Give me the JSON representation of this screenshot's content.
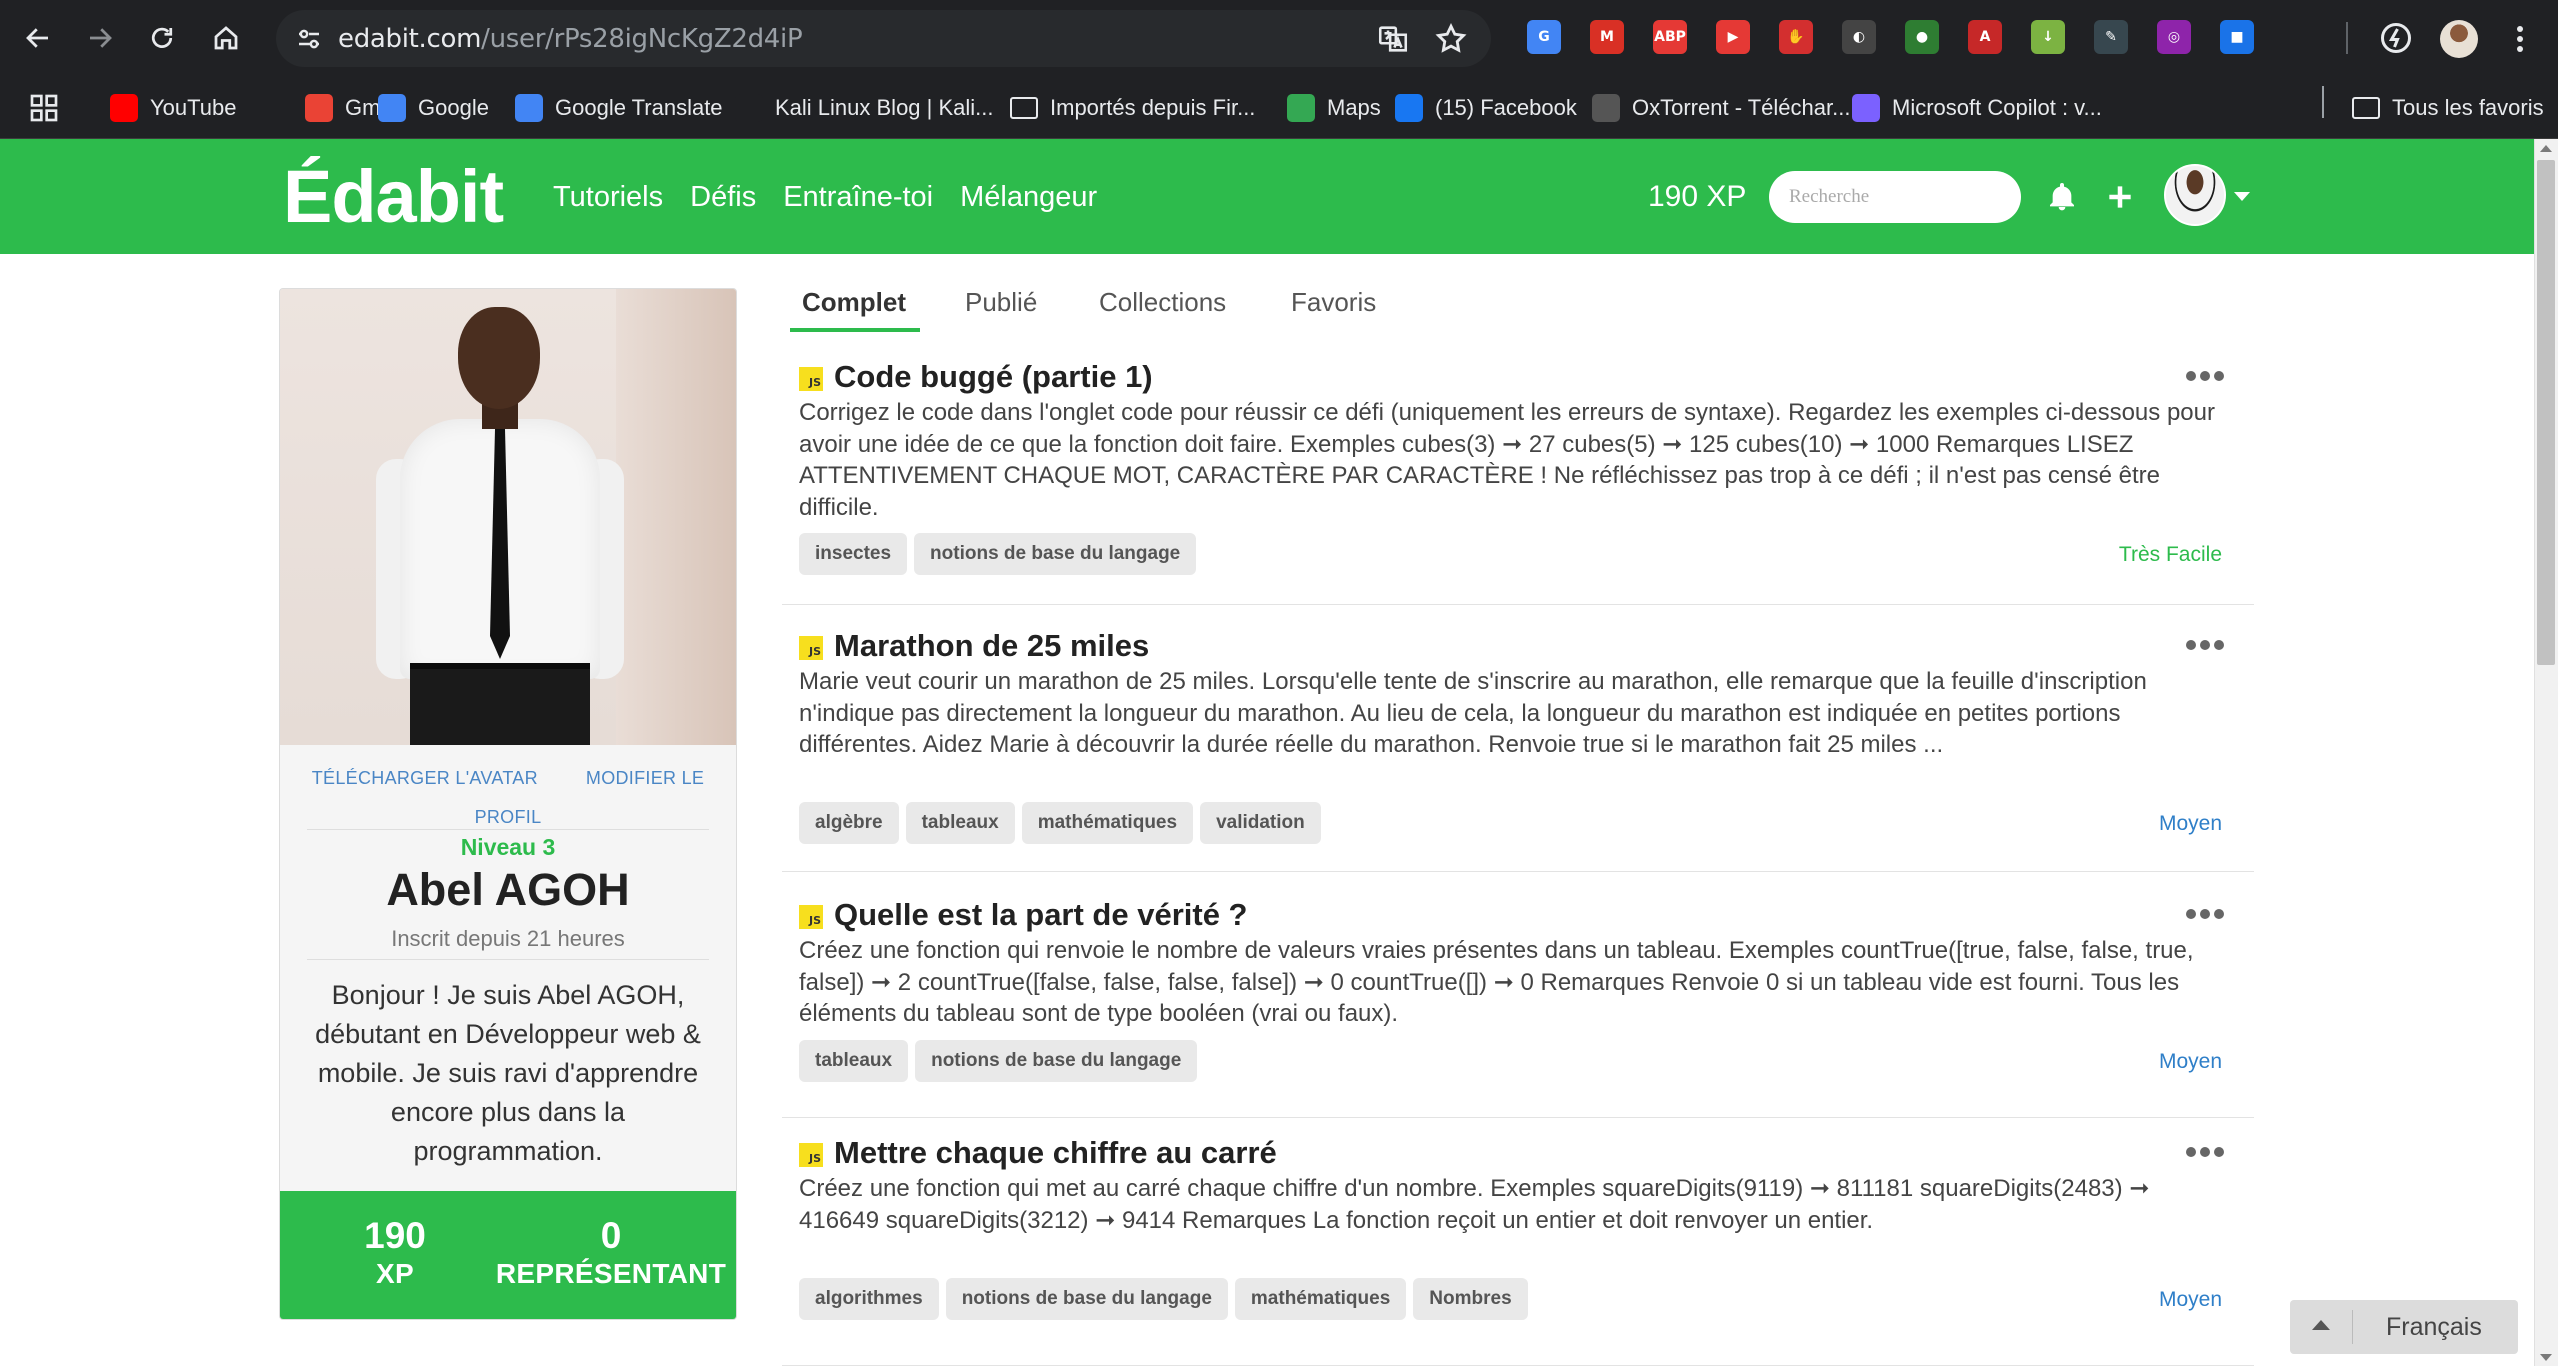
{
  "browser": {
    "url_host": "edabit.com",
    "url_path": "/user/rPs28igNcKgZ2d4iP",
    "extensions": [
      {
        "icon": "translate-ext-icon",
        "label": "G",
        "color": "#4285f4"
      },
      {
        "icon": "gmail-ext-icon",
        "label": "M",
        "color": "#d93025"
      },
      {
        "icon": "adblock-ext-icon",
        "label": "ABP",
        "color": "#e53935"
      },
      {
        "icon": "video-ext-icon",
        "label": "▶",
        "color": "#e53935"
      },
      {
        "icon": "stop-ext-icon",
        "label": "✋",
        "color": "#d32f2f"
      },
      {
        "icon": "dark-ext-icon",
        "label": "◐",
        "color": "#444444"
      },
      {
        "icon": "earth-ext-icon",
        "label": "●",
        "color": "#2e7d32"
      },
      {
        "icon": "pdf-ext-icon",
        "label": "A",
        "color": "#c62828"
      },
      {
        "icon": "download-ext-icon",
        "label": "↓",
        "color": "#7cb342"
      },
      {
        "icon": "eyedropper-ext-icon",
        "label": "✎",
        "color": "#37474f"
      },
      {
        "icon": "color-ext-icon",
        "label": "◎",
        "color": "#8e24aa"
      },
      {
        "icon": "badge-ext-icon",
        "label": "■",
        "color": "#1a73e8"
      }
    ],
    "bookmarks": [
      {
        "label": "YouTube",
        "icon": "youtube-icon",
        "color": "#ff0000"
      },
      {
        "label": "Gmail",
        "icon": "gmail-icon",
        "color": "#ea4335"
      },
      {
        "label": "Google",
        "icon": "google-icon",
        "color": "#4285f4"
      },
      {
        "label": "Google Translate",
        "icon": "translate-icon",
        "color": "#4285f4"
      },
      {
        "label": "Kali Linux Blog | Kali...",
        "icon": "kali-icon",
        "color": "#202124"
      },
      {
        "label": "Importés depuis Fir...",
        "icon": "folder-icon",
        "color": ""
      },
      {
        "label": "Maps",
        "icon": "maps-icon",
        "color": "#34a853"
      },
      {
        "label": "(15) Facebook",
        "icon": "facebook-icon",
        "color": "#1877f2"
      },
      {
        "label": "OxTorrent - Téléchar...",
        "icon": "oxtorrent-icon",
        "color": "#555555"
      },
      {
        "label": "Microsoft Copilot : v...",
        "icon": "copilot-icon",
        "color": "#7b61ff"
      }
    ],
    "all_bookmarks": "Tous les favoris"
  },
  "header": {
    "logo": "Édabit",
    "nav": [
      "Tutoriels",
      "Défis",
      "Entraîne-toi",
      "Mélangeur"
    ],
    "xp": "190 XP",
    "search_placeholder": "Recherche",
    "brand_color": "#2dbb4c"
  },
  "profile": {
    "upload_avatar": "TÉLÉCHARGER L'AVATAR",
    "edit_profile_1": "MODIFIER LE",
    "edit_profile_2": "PROFIL",
    "level": "Niveau 3",
    "name": "Abel AGOH",
    "joined": "Inscrit  depuis 21 heures",
    "bio": "Bonjour ! Je suis Abel AGOH, débutant en Développeur web & mobile. Je suis ravi d'apprendre encore plus dans la programmation.",
    "stats": [
      {
        "value": "190",
        "label": "XP"
      },
      {
        "value": "0",
        "label": "REPRÉSENTANT"
      }
    ]
  },
  "tabs": [
    "Complet",
    "Publié",
    "Collections",
    "Favoris"
  ],
  "challenges": [
    {
      "lang": "JS",
      "title": "Code buggé (partie 1)",
      "desc": "Corrigez le code dans l'onglet code pour réussir ce défi (uniquement les erreurs de syntaxe). Regardez les exemples ci-dessous pour avoir une idée de ce que la fonction doit faire. Exemples cubes(3) ➞ 27 cubes(5) ➞ 125 cubes(10) ➞ 1000 Remarques LISEZ ATTENTIVEMENT CHAQUE MOT, CARACTÈRE PAR CARACTÈRE ! Ne réfléchissez pas trop à ce défi ; il n'est pas censé être difficile.",
      "tags": [
        "insectes",
        "notions de base du langage"
      ],
      "difficulty": "Très Facile",
      "difficulty_color": "#2dbb4c"
    },
    {
      "lang": "JS",
      "title": "Marathon de 25 miles",
      "desc": "Marie veut courir un marathon de 25 miles. Lorsqu'elle tente de s'inscrire au marathon, elle remarque que la feuille d'inscription n'indique pas directement la longueur du marathon. Au lieu de cela, la longueur du marathon est indiquée en petites portions différentes. Aidez Marie à découvrir la durée réelle du marathon. Renvoie true si le marathon fait 25 miles ...",
      "tags": [
        "algèbre",
        "tableaux",
        "mathématiques",
        "validation"
      ],
      "difficulty": "Moyen",
      "difficulty_color": "#2f7fc8"
    },
    {
      "lang": "JS",
      "title": "Quelle est la part de vérité ?",
      "desc": "Créez une fonction qui renvoie le nombre de valeurs vraies présentes dans un tableau. Exemples countTrue([true, false, false, true, false]) ➞ 2 countTrue([false, false, false, false]) ➞ 0 countTrue([]) ➞ 0 Remarques Renvoie 0 si un tableau vide est fourni. Tous les éléments du tableau sont de type booléen (vrai ou faux).",
      "tags": [
        "tableaux",
        "notions de base du langage"
      ],
      "difficulty": "Moyen",
      "difficulty_color": "#2f7fc8"
    },
    {
      "lang": "JS",
      "title": "Mettre chaque chiffre au carré",
      "desc": "Créez une fonction qui met au carré chaque chiffre d'un nombre. Exemples squareDigits(9119) ➞ 811181 squareDigits(2483) ➞ 416649 squareDigits(3212) ➞ 9414 Remarques La fonction reçoit un entier et doit renvoyer un entier.",
      "tags": [
        "algorithmes",
        "notions de base du langage",
        "mathématiques",
        "Nombres"
      ],
      "difficulty": "Moyen",
      "difficulty_color": "#2f7fc8"
    }
  ],
  "language": "Français"
}
